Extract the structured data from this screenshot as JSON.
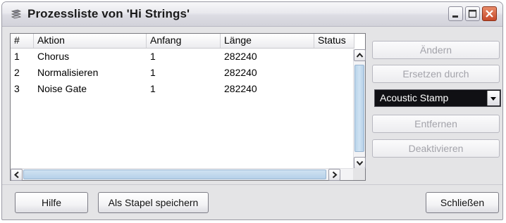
{
  "window": {
    "title": "Prozessliste von 'Hi Strings'",
    "app_icon": "stacked-process-icon",
    "controls": [
      "minimize-icon",
      "maximize-icon",
      "close-icon"
    ]
  },
  "list": {
    "columns": [
      "#",
      "Aktion",
      "Anfang",
      "Länge",
      "Status"
    ],
    "rows": [
      {
        "num": "1",
        "action": "Chorus",
        "start": "1",
        "length": "282240",
        "status": ""
      },
      {
        "num": "2",
        "action": "Normalisieren",
        "start": "1",
        "length": "282240",
        "status": ""
      },
      {
        "num": "3",
        "action": "Noise Gate",
        "start": "1",
        "length": "282240",
        "status": ""
      }
    ]
  },
  "side": {
    "modify": "Ändern",
    "replace": "Ersetzen durch",
    "plugin_select": "Acoustic Stamp",
    "remove": "Entfernen",
    "deactivate": "Deaktivieren"
  },
  "footer": {
    "help": "Hilfe",
    "save_batch": "Als Stapel speichern",
    "close": "Schließen"
  },
  "colors": {
    "select_bg": "#101014",
    "scroll_thumb": "#cfe2f2",
    "close_button": "#c5482a"
  }
}
